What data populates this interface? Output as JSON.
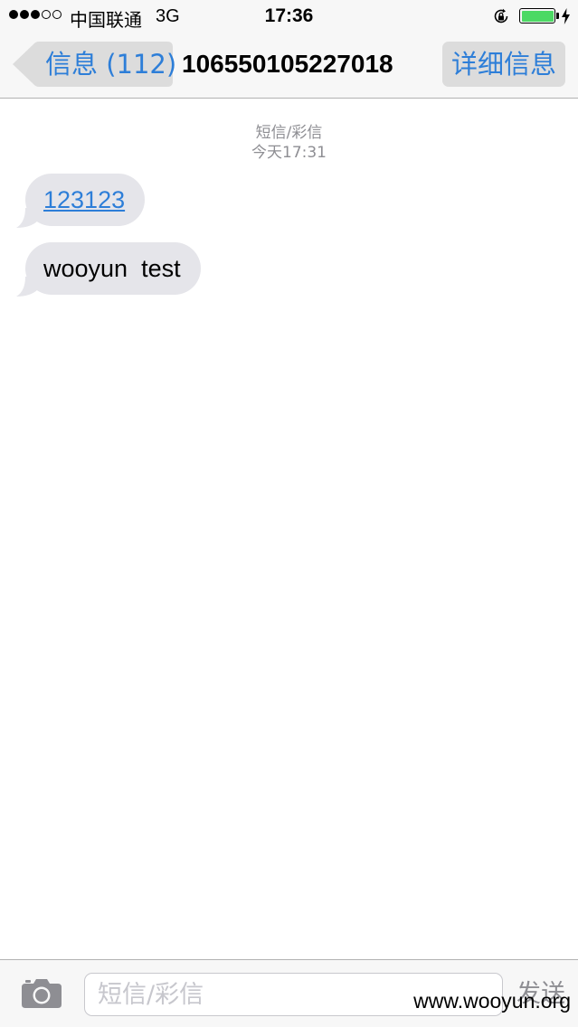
{
  "status_bar": {
    "signal_filled": 3,
    "signal_total": 5,
    "carrier": "中国联通",
    "network": "3G",
    "time": "17:36",
    "battery_level": 1.0,
    "icons": [
      "rotation-lock-icon",
      "battery-icon",
      "charging-bolt-icon"
    ]
  },
  "nav": {
    "back_label": "信息 (112)",
    "title": "10655010522701​8",
    "details_label": "详细信息"
  },
  "thread": {
    "timestamp_type": "短信/彩信",
    "timestamp_time": "今天17:31",
    "messages": [
      {
        "text": "123123",
        "is_link": true
      },
      {
        "text": "wooyun  test",
        "is_link": false
      }
    ]
  },
  "input_bar": {
    "placeholder": "短信/彩信",
    "value": "",
    "send_label": "发送",
    "camera_icon": "camera-icon"
  },
  "watermark": "www.wooyun.org",
  "colors": {
    "accent": "#2d7ed8",
    "bubble_incoming": "#e5e5ea",
    "bar_background": "#f7f7f7",
    "secondary_text": "#8e8e93",
    "battery": "#4cd964"
  }
}
